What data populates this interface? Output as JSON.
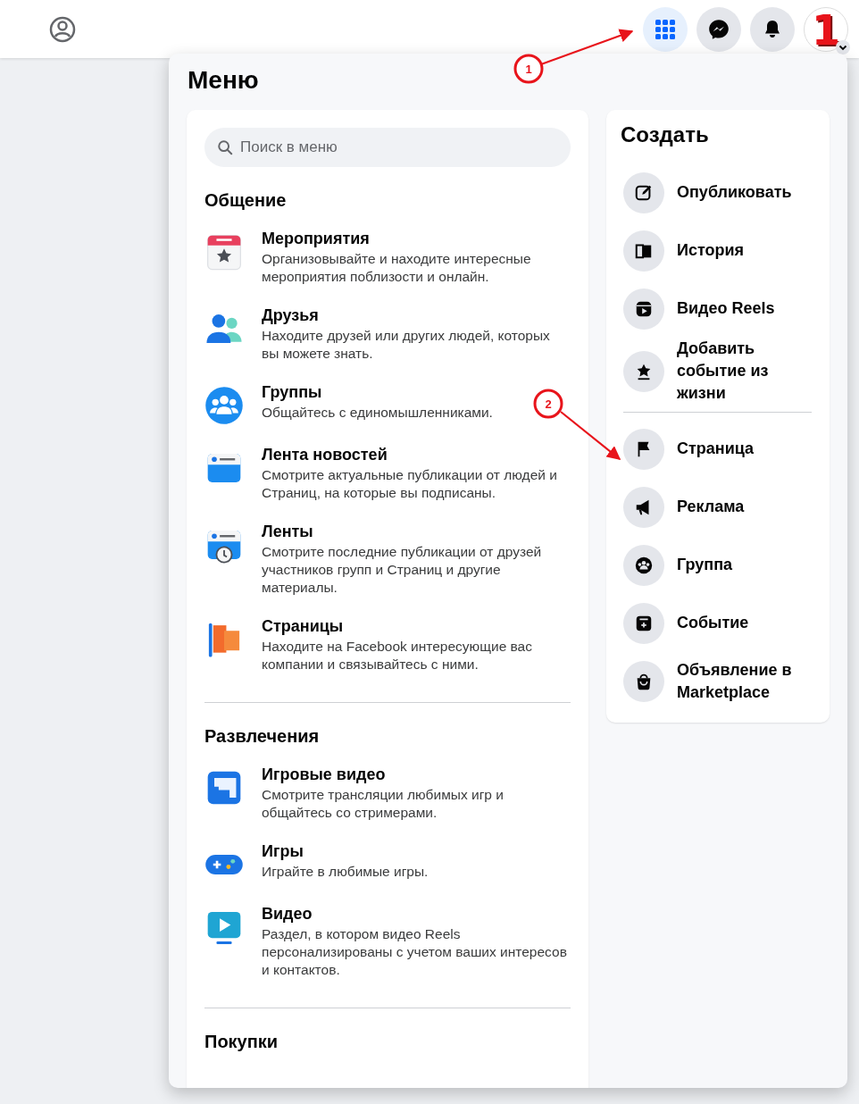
{
  "header": {
    "avatar_text": "1"
  },
  "menu": {
    "title": "Меню",
    "search": {
      "placeholder": "Поиск в меню"
    },
    "sections": [
      {
        "heading": "Общение",
        "items": [
          {
            "title": "Мероприятия",
            "description": "Организовывайте и находите интересные мероприятия поблизости и онлайн."
          },
          {
            "title": "Друзья",
            "description": "Находите друзей или других людей, которых вы можете знать."
          },
          {
            "title": "Группы",
            "description": "Общайтесь с единомышленниками."
          },
          {
            "title": "Лента новостей",
            "description": "Смотрите актуальные публикации от людей и Страниц, на которые вы подписаны."
          },
          {
            "title": "Ленты",
            "description": "Смотрите последние публикации от друзей участников групп и Страниц и другие материалы."
          },
          {
            "title": "Страницы",
            "description": "Находите на Facebook интересующие вас компании и связывайтесь с ними."
          }
        ]
      },
      {
        "heading": "Развлечения",
        "items": [
          {
            "title": "Игровые видео",
            "description": "Смотрите трансляции любимых игр и общайтесь со стримерами."
          },
          {
            "title": "Игры",
            "description": "Играйте в любимые игры."
          },
          {
            "title": "Видео",
            "description": "Раздел, в котором видео Reels персонализированы с учетом ваших интересов и контактов."
          }
        ]
      },
      {
        "heading": "Покупки"
      }
    ]
  },
  "create": {
    "title": "Создать",
    "groups": [
      [
        "Опубликовать",
        "История",
        "Видео Reels",
        "Добавить событие из жизни"
      ],
      [
        "Страница",
        "Реклама",
        "Группа",
        "Событие",
        "Объявление в Marketplace"
      ]
    ]
  },
  "annotations": [
    {
      "label": "1"
    },
    {
      "label": "2"
    }
  ]
}
